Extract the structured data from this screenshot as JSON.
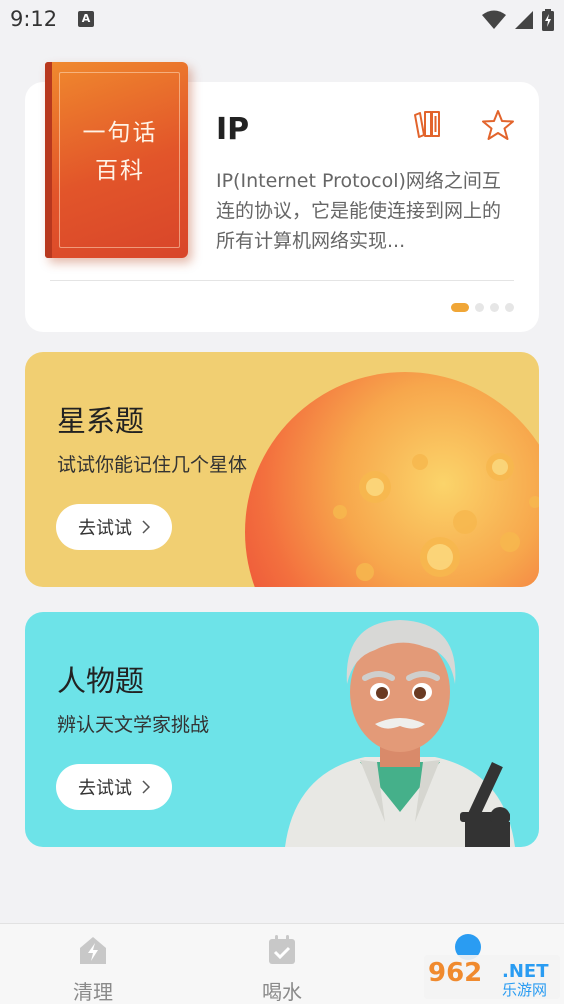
{
  "status_bar": {
    "time": "9:12",
    "notif": "A"
  },
  "wiki": {
    "book_line1": "一句话",
    "book_line2": "百科",
    "title": "IP",
    "description": "IP(Internet Protocol)网络之间互连的协议，它是能使连接到网上的所有计算机网络实现...",
    "active_page": 1,
    "page_count": 4
  },
  "quizzes": [
    {
      "title": "星系题",
      "subtitle": "试试你能记住几个星体",
      "button": "去试试"
    },
    {
      "title": "人物题",
      "subtitle": "辨认天文学家挑战",
      "button": "去试试"
    }
  ],
  "tabs": [
    {
      "label": "清理",
      "icon": "lightning-house-icon"
    },
    {
      "label": "喝水",
      "icon": "calendar-check-icon"
    }
  ],
  "watermark": {
    "number": "962",
    "suffix": ".NET",
    "sub": "乐游网"
  },
  "colors": {
    "accent": "#f0a637",
    "star_card": "#f1cf72",
    "person_card": "#6de3e8",
    "book": "#e2552a",
    "active_tab": "#2a9cf2"
  }
}
